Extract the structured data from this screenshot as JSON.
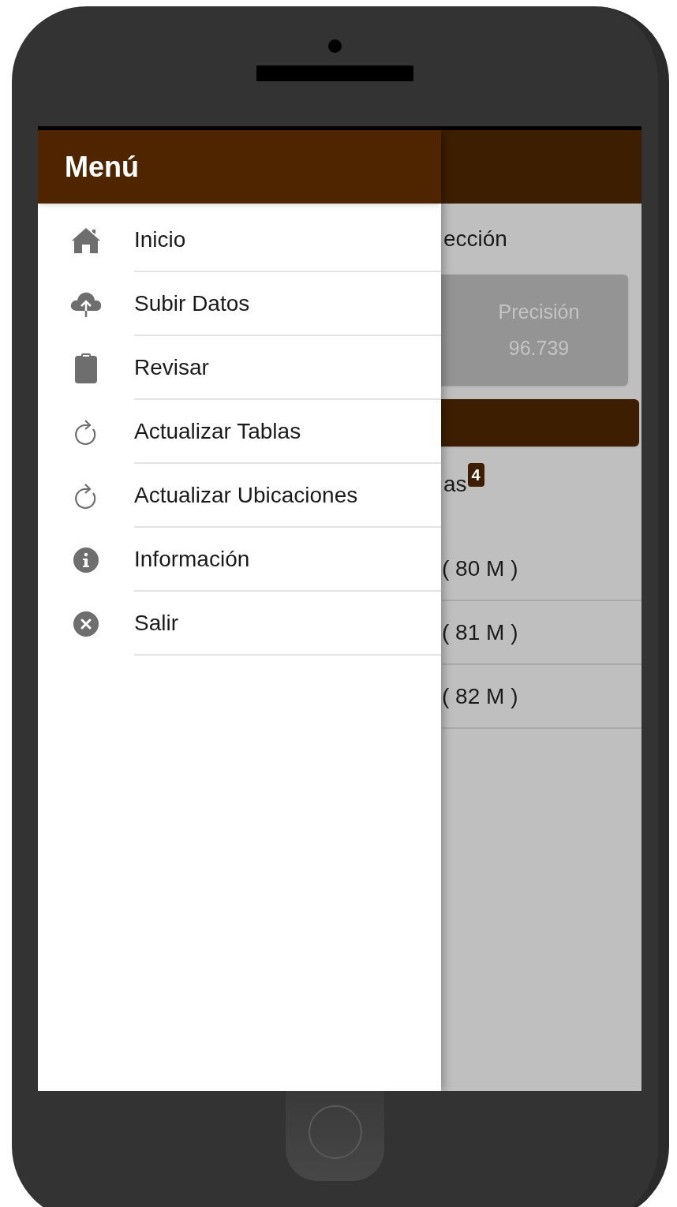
{
  "drawer": {
    "title": "Menú",
    "items": [
      {
        "label": "Inicio"
      },
      {
        "label": "Subir Datos"
      },
      {
        "label": "Revisar"
      },
      {
        "label": "Actualizar Tablas"
      },
      {
        "label": "Actualizar Ubicaciones"
      },
      {
        "label": "Información"
      },
      {
        "label": "Salir"
      }
    ]
  },
  "background": {
    "heading": "ección",
    "card": {
      "label": "Precisión",
      "value": "96.739"
    },
    "section": {
      "label": "as",
      "badge": "4"
    },
    "rows": [
      {
        "text": "( 80 M )"
      },
      {
        "text": "( 81 M )"
      },
      {
        "text": "( 82 M )"
      }
    ]
  }
}
